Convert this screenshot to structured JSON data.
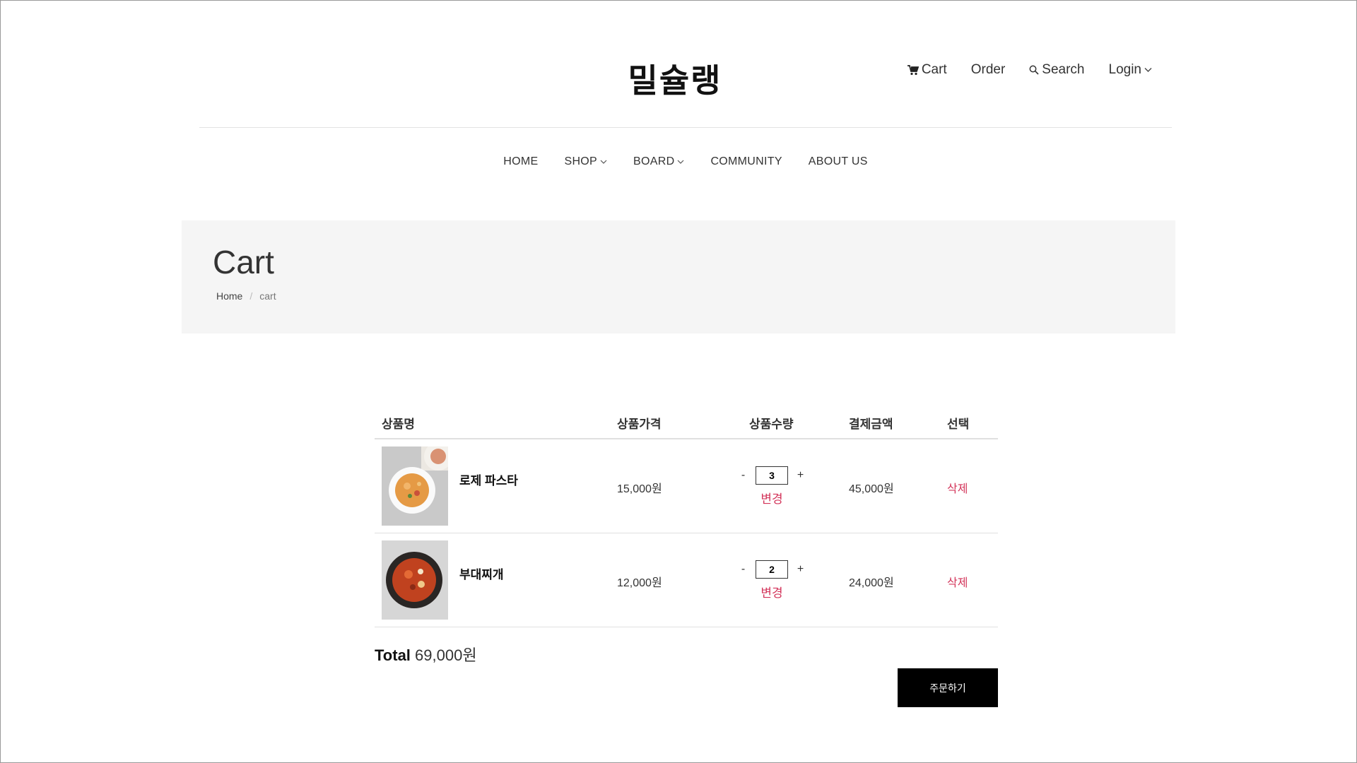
{
  "header": {
    "brand": "밀슐랭",
    "util": [
      {
        "label": "Cart",
        "icon": "cart-icon"
      },
      {
        "label": "Order"
      },
      {
        "label": "Search",
        "icon": "search-icon"
      },
      {
        "label": "Login",
        "icon": "chevron-down-icon"
      }
    ]
  },
  "nav": [
    {
      "label": "HOME"
    },
    {
      "label": "SHOP",
      "icon": "chevron-down-icon"
    },
    {
      "label": "BOARD",
      "icon": "chevron-down-icon"
    },
    {
      "label": "COMMUNITY"
    },
    {
      "label": "ABOUT US"
    }
  ],
  "page": {
    "title": "Cart",
    "breadcrumb": {
      "home": "Home",
      "sep": "/",
      "current": "cart"
    }
  },
  "cart": {
    "headers": {
      "name": "상품명",
      "price": "상품가격",
      "qty": "상품수량",
      "amount": "결제금액",
      "select": "선택"
    },
    "items": [
      {
        "name": "로제 파스타",
        "price": "15,000원",
        "qty": "3",
        "amount": "45,000원",
        "change": "변경",
        "delete": "삭제",
        "minus": "-",
        "plus": "+"
      },
      {
        "name": "부대찌개",
        "price": "12,000원",
        "qty": "2",
        "amount": "24,000원",
        "change": "변경",
        "delete": "삭제",
        "minus": "-",
        "plus": "+"
      }
    ],
    "total_label": "Total",
    "total_value": "69,000원",
    "order_button": "주문하기"
  },
  "colors": {
    "accent": "#d3345a",
    "band": "#f5f5f5",
    "button": "#000000"
  }
}
